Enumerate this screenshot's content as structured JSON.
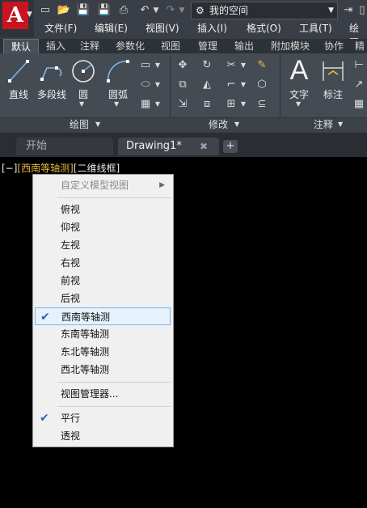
{
  "app": {
    "logo_letter": "A",
    "workspace": "我的空间"
  },
  "menubar": [
    "文件(F)",
    "编辑(E)",
    "视图(V)",
    "插入(I)",
    "格式(O)",
    "工具(T)",
    "绘图"
  ],
  "ribbon_tabs": [
    "默认",
    "插入",
    "注释",
    "参数化",
    "视图",
    "管理",
    "输出",
    "附加模块",
    "协作",
    "精"
  ],
  "active_ribbon_tab": "默认",
  "draw_panel": {
    "label": "绘图",
    "tools": [
      "直线",
      "多段线",
      "圆",
      "圆弧"
    ]
  },
  "modify_panel": {
    "label": "修改"
  },
  "annotation_panel": {
    "label": "注释",
    "tools": [
      "文字",
      "标注"
    ]
  },
  "doc_tabs": {
    "start": "开始",
    "drawing": "Drawing1*",
    "close": "✖",
    "add": "+"
  },
  "viewport": {
    "minus": "[−]",
    "view": "[西南等轴测]",
    "style": "[二维线框]"
  },
  "context_menu": {
    "custom_views": "自定义模型视图",
    "views": [
      "俯视",
      "仰视",
      "左视",
      "右视",
      "前视",
      "后视",
      "西南等轴测",
      "东南等轴测",
      "东北等轴测",
      "西北等轴测"
    ],
    "checked_view": "西南等轴测",
    "view_manager": "视图管理器...",
    "projection": [
      "平行",
      "透视"
    ],
    "checked_projection": "平行",
    "check_mark": "✔"
  }
}
